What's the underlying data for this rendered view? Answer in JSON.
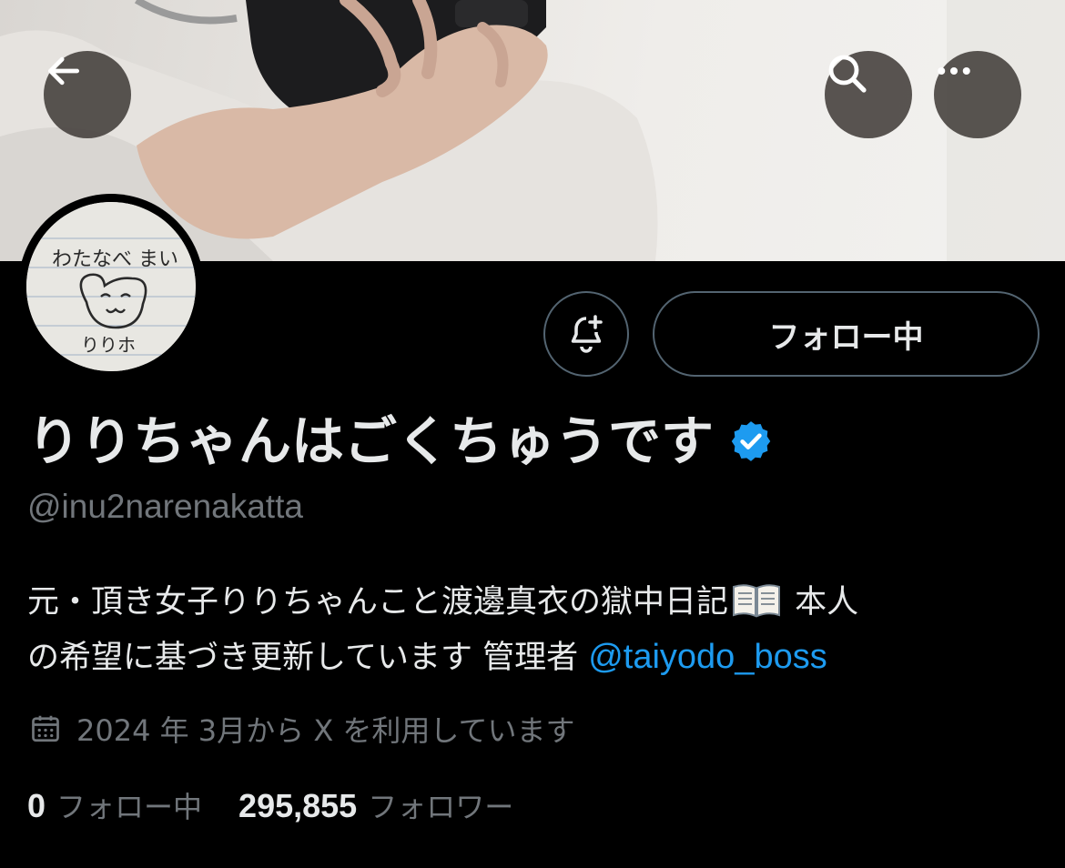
{
  "header": {
    "back_icon": "arrow-left-icon",
    "search_icon": "search-icon",
    "more_icon": "more-horizontal-icon"
  },
  "profile": {
    "display_name": "りりちゃんはごくちゅうです",
    "verified": true,
    "verified_color": "#1d9bf0",
    "handle": "@inu2narenakatta",
    "bio_line1": "元・頂き女子りりちゃんこと渡邊真衣の獄中日記",
    "bio_line1_after": " 本人",
    "bio_line2": "の希望に基づき更新しています 管理者 ",
    "bio_mention": "@taiyodo_boss",
    "joined": "2024 年 3月から X を利用しています",
    "following_count": "0",
    "following_label": "フォロー中",
    "followers_count": "295,855",
    "followers_label": "フォロワー"
  },
  "avatar": {
    "drawing_text_top": "わたなべ まい",
    "drawing_text_bottom": "りりホ"
  },
  "actions": {
    "notify_icon": "bell-plus-icon",
    "follow_button_label": "フォロー中"
  },
  "colors": {
    "background": "#000000",
    "text_primary": "#e7e9ea",
    "text_secondary": "#71767b",
    "link": "#1d9bf0",
    "border": "#536471"
  }
}
